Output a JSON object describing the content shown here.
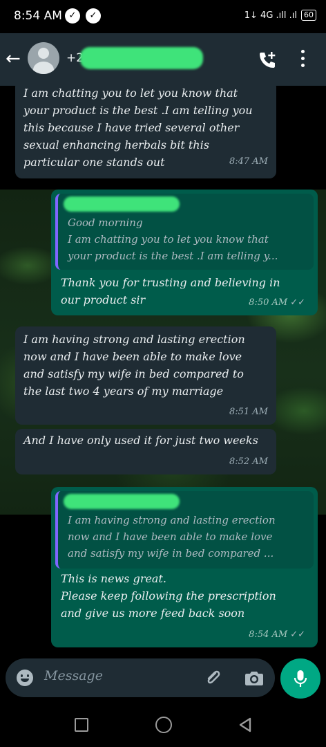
{
  "status_bar": {
    "time": "8:54 AM",
    "indicators": "1↓ 4G .ıll .ıl",
    "battery": "60"
  },
  "header": {
    "contact_name": "+2",
    "icons": [
      "back-arrow-icon",
      "avatar",
      "add-call-icon",
      "more-vert-icon"
    ]
  },
  "messages": [
    {
      "direction": "incoming",
      "text": "I am chatting you to let you know that\nyour product is the best .I am telling you\nthis because I have tried several other\nsexual enhancing herbals bit this\nparticular one stands out",
      "time": "8:47 AM"
    },
    {
      "direction": "outgoing",
      "quote_text": "Good morning\nI am chatting you to let you know that\nyour product is the best .I am telling y...",
      "text": "Thank you for trusting and believing in\nour product sir",
      "time": "8:50 AM",
      "ticks": "✓✓"
    },
    {
      "direction": "incoming",
      "text": "I am having strong and lasting erection\nnow and I have been able to make love\nand satisfy  my wife in bed compared to\nthe last two 4 years of my marriage",
      "time": "8:51 AM"
    },
    {
      "direction": "incoming",
      "text": "And I have only used it for just two weeks",
      "time": "8:52 AM"
    },
    {
      "direction": "outgoing",
      "quote_text": "I am having strong and lasting erection\nnow and I have been able to make love\nand satisfy  my wife in bed compared ...",
      "text": "This is news great.\nPlease keep following the prescription\nand give us more feed back soon",
      "time": "8:54 AM",
      "ticks": "✓✓"
    }
  ],
  "input": {
    "placeholder": "Message"
  },
  "colors": {
    "incoming_bubble": "#1f2c34",
    "outgoing_bubble": "#005c4b",
    "accent": "#00a884",
    "quote_bar": "#7f66ff",
    "redaction": "#3fe37a"
  }
}
